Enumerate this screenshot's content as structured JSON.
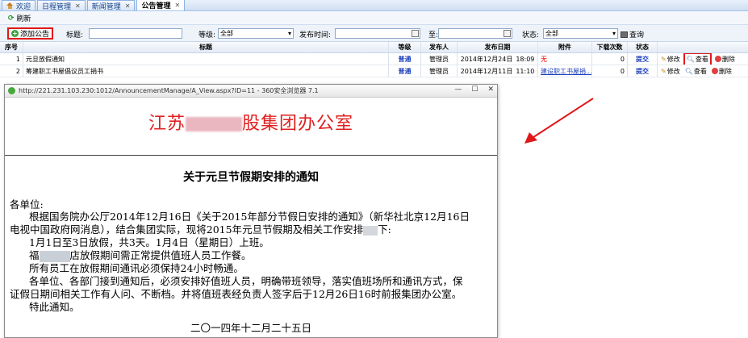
{
  "tabs": [
    {
      "label": "欢迎",
      "closable": false
    },
    {
      "label": "日程管理",
      "closable": true
    },
    {
      "label": "新闻管理",
      "closable": true
    },
    {
      "label": "公告管理",
      "closable": true
    }
  ],
  "toolbar": {
    "refresh_label": "刷新",
    "add_label": "添加公告",
    "query_label": "查询"
  },
  "search": {
    "title_label": "标题:",
    "level_label": "等级:",
    "level_value": "全部",
    "publish_time_label": "发布时间:",
    "to_label": "至:",
    "status_label": "状态:",
    "status_value": "全部"
  },
  "grid": {
    "headers": [
      "序号",
      "标题",
      "等级",
      "发布人",
      "发布日期",
      "附件",
      "下载次数",
      "状态"
    ],
    "rows": [
      {
        "no": "1",
        "title": "元旦放假通知",
        "level": "普通",
        "publisher": "管理员",
        "date": "2014年12月24日",
        "time": "18:09",
        "attachment": "无",
        "downloads": "0",
        "status": "提交"
      },
      {
        "no": "2",
        "title": "筹建职工书屋倡议员工捐书",
        "level": "普通",
        "publisher": "管理员",
        "date": "2014年12月11日",
        "time": "11:10",
        "attachment": "建设职工书屋捐...",
        "downloads": "0",
        "status": "提交"
      }
    ],
    "actions": {
      "edit": "修改",
      "view": "查看",
      "delete": "删除"
    }
  },
  "popup": {
    "url": "http://221.231.103.230:1012/AnnouncementManage/A_View.aspx?ID=11 - 360安全浏览器 7.1",
    "org_left": "江苏",
    "org_right": "股集团办公室",
    "doc_title": "关于元旦节假期安排的通知",
    "paragraphs": {
      "p0": "各单位:",
      "p1": "根据国务院办公厅2014年12月16日《关于2015年部分节假日安排的通知》（新华社北京12月16日",
      "p2a": "电视中国政府网消息），结合集团实际，现将2015年元旦节假期及相关工作安排",
      "p2b": "下:",
      "p3": "1月1日至3日放假，共3天。1月4日（星期日）上班。",
      "p4a": "福",
      "p4b": "店放假期间需正常提供值班人员工作餐。",
      "p5": "所有员工在放假期间通讯必须保持24小时畅通。",
      "p6": "各单位、各部门接到通知后，必须安排好值班人员，明确带班领导，落实值班场所和通讯方式，保",
      "p7": "证假日期间相关工作有人问、不断档。并将值班表经负责人签字后于12月26日16时前报集团办公室。",
      "p8": "特此通知。"
    },
    "sign_date": "二〇一四年十二月二十五日"
  },
  "colors": {
    "accent_red": "#e01818",
    "link_blue": "#1c3fbb",
    "org_red": "#e02020"
  }
}
